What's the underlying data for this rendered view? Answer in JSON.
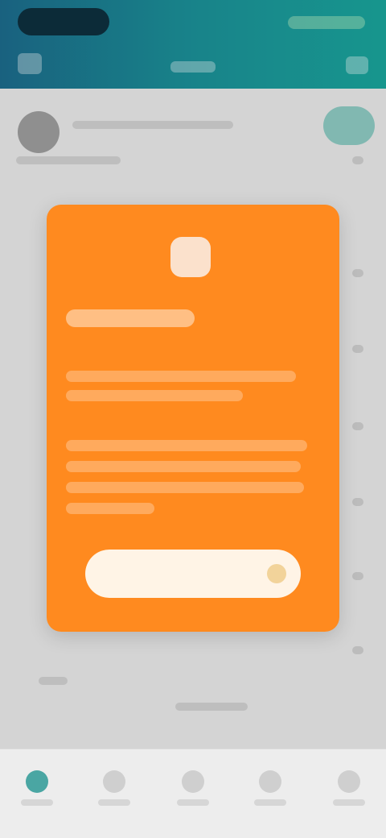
{
  "header": {
    "status_pill_icon": "status-pill-icon",
    "status_right_icon": "status-indicators-icon",
    "menu_icon": "menu-icon",
    "tab_icon": "tab-icon",
    "search_icon": "search-icon"
  },
  "content": {
    "avatar_icon": "avatar-icon",
    "action_pill_icon": "action-pill-icon"
  },
  "promo_card": {
    "logo_icon": "app-logo-icon",
    "cta_icon": "cta-icon",
    "accent_color": "#ff8a1f"
  },
  "bottom_nav": {
    "items": [
      {
        "icon": "home-icon",
        "active": true
      },
      {
        "icon": "nav-icon-2",
        "active": false
      },
      {
        "icon": "nav-icon-3",
        "active": false
      },
      {
        "icon": "nav-icon-4",
        "active": false
      },
      {
        "icon": "nav-icon-5",
        "active": false
      }
    ],
    "active_color": "#4aa6a3"
  }
}
